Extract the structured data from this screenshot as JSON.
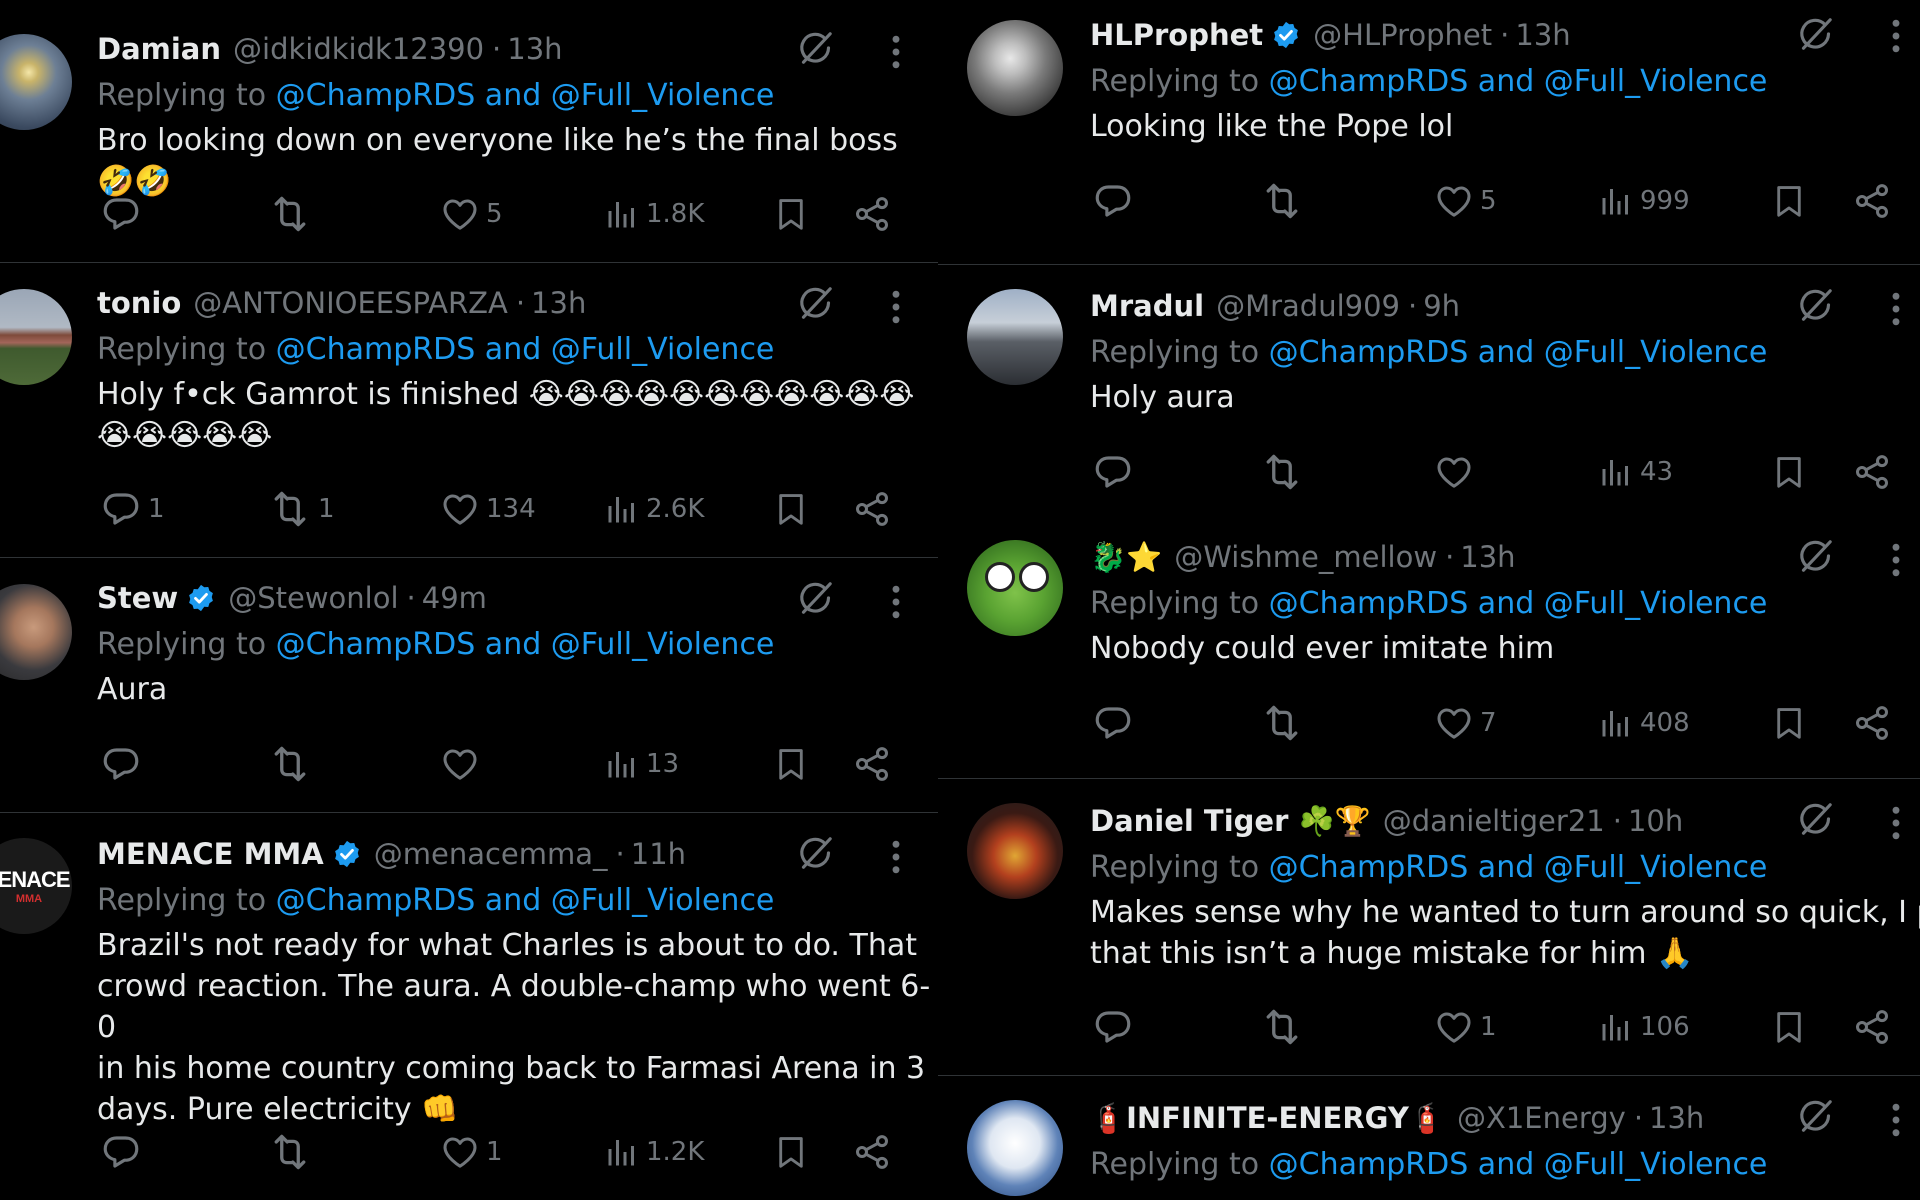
{
  "reply_prefix": "Replying to ",
  "reply_targets": "@ChampRDS and @Full_Violence",
  "colors": {
    "background": "#000000",
    "text": "#e7e9ea",
    "muted": "#71767b",
    "link": "#1d9bf0",
    "verified": "#1d9bf0",
    "divider": "#2f3336"
  },
  "left_column": [
    {
      "name": "Damian",
      "handle": "@idkidkidk12390",
      "time": "13h",
      "verified": false,
      "text": "Bro looking down on everyone like he’s the final boss 🤣🤣",
      "replies": "",
      "reposts": "",
      "likes": "5",
      "views": "1.8K"
    },
    {
      "name": "tonio",
      "handle": "@ANTONIOEESPARZA",
      "time": "13h",
      "verified": false,
      "text": "Holy f•ck Gamrot is finished 😭😭😭😭😭😭😭😭😭😭😭",
      "text2": "😭😭😭😭😭",
      "replies": "1",
      "reposts": "1",
      "likes": "134",
      "views": "2.6K"
    },
    {
      "name": "Stew",
      "handle": "@Stewonlol",
      "time": "49m",
      "verified": true,
      "text": "Aura",
      "replies": "",
      "reposts": "",
      "likes": "",
      "views": "13"
    },
    {
      "name": "MENACE MMA",
      "handle": "@menacemma_",
      "time": "11h",
      "verified": true,
      "avatar_text": "IENACE",
      "avatar_sub": "MMA",
      "lines": [
        "Brazil's not ready for what Charles is about to do. That",
        "crowd reaction. The aura. A double-champ who went 6-0",
        "in his home country coming back to Farmasi Arena in 3",
        "days. Pure electricity 👊"
      ],
      "replies": "",
      "reposts": "",
      "likes": "1",
      "views": "1.2K"
    }
  ],
  "right_column": [
    {
      "name": "HLProphet",
      "handle": "@HLProphet",
      "time": "13h",
      "verified": true,
      "text": "Looking like the Pope lol",
      "replies": "",
      "reposts": "",
      "likes": "5",
      "views": "999"
    },
    {
      "name": "Mradul",
      "handle": "@Mradul909",
      "time": "9h",
      "verified": false,
      "text": "Holy aura",
      "replies": "",
      "reposts": "",
      "likes": "",
      "views": "43"
    },
    {
      "name": "🐉⭐",
      "handle": "@Wishme_mellow",
      "time": "13h",
      "verified": false,
      "text": "Nobody could ever imitate him",
      "replies": "",
      "reposts": "",
      "likes": "7",
      "views": "408"
    },
    {
      "name": "Daniel Tiger ☘️🏆",
      "handle": "@danieltiger21",
      "time": "10h",
      "verified": false,
      "lines": [
        "Makes sense why he wanted to turn around so quick, I pray",
        "that this isn’t a huge mistake for him 🙏"
      ],
      "replies": "",
      "reposts": "",
      "likes": "1",
      "views": "106"
    },
    {
      "name": "🧯INFINITE-ENERGY🧯",
      "handle": "@X1Energy",
      "time": "13h",
      "verified": false
    }
  ]
}
